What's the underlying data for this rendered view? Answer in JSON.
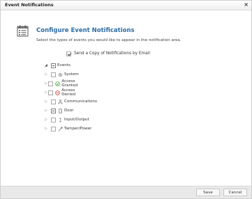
{
  "window": {
    "title": "Event Notifications",
    "close_glyph": "×"
  },
  "header": {
    "icon": "calendar-list-icon",
    "title": "Configure Event Notifications",
    "description": "Select the types of events you would like to appear in the notification area."
  },
  "email": {
    "label": "Send a Copy of Notifications by Email",
    "checked": true
  },
  "tree": {
    "root": {
      "label": "Events",
      "expanded": true
    },
    "items": [
      {
        "label": "System",
        "icon": "gear-icon",
        "checked": false
      },
      {
        "label": "Access Granted",
        "icon": "check-circle-icon",
        "checked": false
      },
      {
        "label": "Access Denied",
        "icon": "denied-circle-icon",
        "checked": false
      },
      {
        "label": "Communications",
        "icon": "network-icon",
        "checked": false
      },
      {
        "label": "Door",
        "icon": "door-icon",
        "checked": false
      },
      {
        "label": "Input/Output",
        "icon": "io-icon",
        "checked": false
      },
      {
        "label": "Tamper/Power",
        "icon": "tamper-power-icon",
        "checked": false
      }
    ]
  },
  "footer": {
    "save_label": "Save",
    "cancel_label": "Cancel"
  },
  "colors": {
    "heading": "#2e6da4",
    "footer_bg": "#e9e9e9",
    "granted": "#3aa63a",
    "denied": "#d33a3a"
  }
}
